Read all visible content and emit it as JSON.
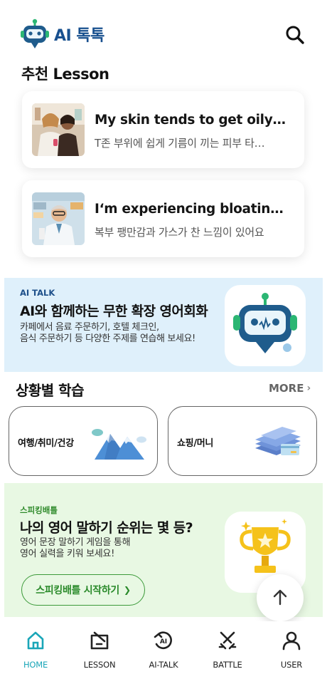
{
  "header": {
    "logo_text": "AI 톡톡",
    "search_icon": "search-icon"
  },
  "recommended": {
    "title": "추천 Lesson",
    "lessons": [
      {
        "title": "My skin tends to get oily in…",
        "subtitle": "T존 부위에 쉽게 기름이 끼는 피부 타…"
      },
      {
        "title": "I‘m experiencing bloating…",
        "subtitle": "복부 팽만감과 가스가 찬 느낌이 있어요"
      }
    ]
  },
  "ai_talk": {
    "tag": "AI TALK",
    "title": "AI와 함께하는 무한 확장 영어회화",
    "desc_line1": "카페에서 음료 주문하기, 호텔 체크인,",
    "desc_line2": "음식 주문하기 등 다양한 주제를 연습해 보세요!"
  },
  "situation": {
    "title": "상황별 학습",
    "more_label": "MORE",
    "cards": [
      {
        "label": "여행/취미/건강",
        "icon": "mountain-icon"
      },
      {
        "label": "쇼핑/머니",
        "icon": "money-icon"
      }
    ]
  },
  "speaking_battle": {
    "tag": "스피킹배틀",
    "title": "나의 영어 말하기 순위는 몇 등?",
    "desc_line1": "영어 문장 말하기 게임을 통해",
    "desc_line2": "영어 실력을 키워 보세요!",
    "button_label": "스피킹배틀 시작하기",
    "button_chevron": "❯"
  },
  "bottom_nav": [
    {
      "label": "HOME",
      "icon": "home-icon",
      "active": true
    },
    {
      "label": "LESSON",
      "icon": "lesson-icon",
      "active": false
    },
    {
      "label": "AI-TALK",
      "icon": "ai-talk-icon",
      "active": false
    },
    {
      "label": "BATTLE",
      "icon": "battle-icon",
      "active": false
    },
    {
      "label": "USER",
      "icon": "user-icon",
      "active": false
    }
  ],
  "colors": {
    "brand_blue": "#18508f",
    "accent_teal": "#1aa6b8",
    "aitalk_bg": "#dff0fb",
    "battle_bg": "#e8f8e3",
    "battle_green": "#2e8a2a"
  }
}
